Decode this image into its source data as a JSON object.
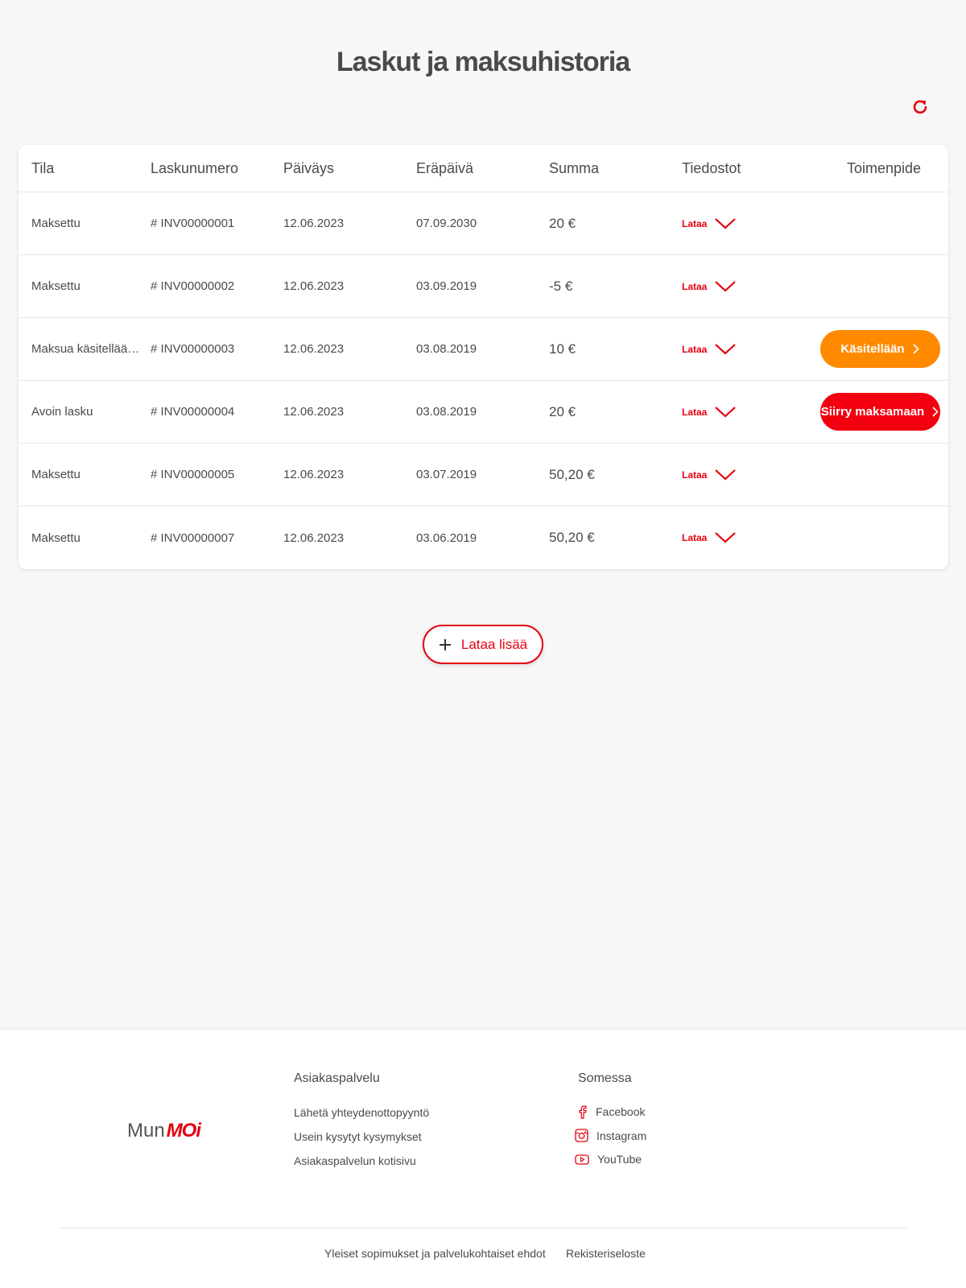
{
  "page": {
    "title": "Laskut ja maksuhistoria",
    "refresh_icon": "refresh-icon"
  },
  "table": {
    "headers": [
      "Tila",
      "Laskunumero",
      "Päiväys",
      "Eräpäivä",
      "Summa",
      "Tiedostot",
      "Toimenpide"
    ],
    "rows": [
      {
        "status": "Maksettu",
        "number": "# INV00000001",
        "date": "12.06.2023",
        "due": "07.09.2030",
        "amount": "20 €",
        "download": "Lataa",
        "action": ""
      },
      {
        "status": "Maksettu",
        "number": "# INV00000002",
        "date": "12.06.2023",
        "due": "03.09.2019",
        "amount": "-5 €",
        "download": "Lataa",
        "action": ""
      },
      {
        "status": "Maksua käsitellään...",
        "number": "# INV00000003",
        "date": "12.06.2023",
        "due": "03.08.2019",
        "amount": "10 €",
        "download": "Lataa",
        "action": "Käsitellään"
      },
      {
        "status": "Avoin lasku",
        "number": "# INV00000004",
        "date": "12.06.2023",
        "due": "03.08.2019",
        "amount": "20 €",
        "download": "Lataa",
        "action": "Siirry maksamaan"
      },
      {
        "status": "Maksettu",
        "number": "# INV00000005",
        "date": "12.06.2023",
        "due": "03.07.2019",
        "amount": "50,20 €",
        "download": "Lataa",
        "action": ""
      },
      {
        "status": "Maksettu",
        "number": "# INV00000007",
        "date": "12.06.2023",
        "due": "03.06.2019",
        "amount": "50,20 €",
        "download": "Lataa",
        "action": ""
      }
    ]
  },
  "load_more": {
    "label": "Lataa lisää"
  },
  "footer": {
    "logo_mun": "Mun",
    "logo_moi": "MOi",
    "customer_service": {
      "title": "Asiakaspalvelu",
      "links": [
        "Lähetä yhteydenottopyyntö",
        "Usein kysytyt kysymykset",
        "Asiakaspalvelun kotisivu"
      ]
    },
    "social": {
      "title": "Somessa",
      "links": [
        "Facebook",
        "Instagram",
        "YouTube"
      ]
    },
    "bottom_links": [
      "Yleiset sopimukset ja palvelukohtaiset ehdot",
      "Rekisteriseloste"
    ]
  },
  "colors": {
    "brand_red": "#e3000f",
    "orange": "#ff8a00",
    "background": "#f7f7f7"
  }
}
